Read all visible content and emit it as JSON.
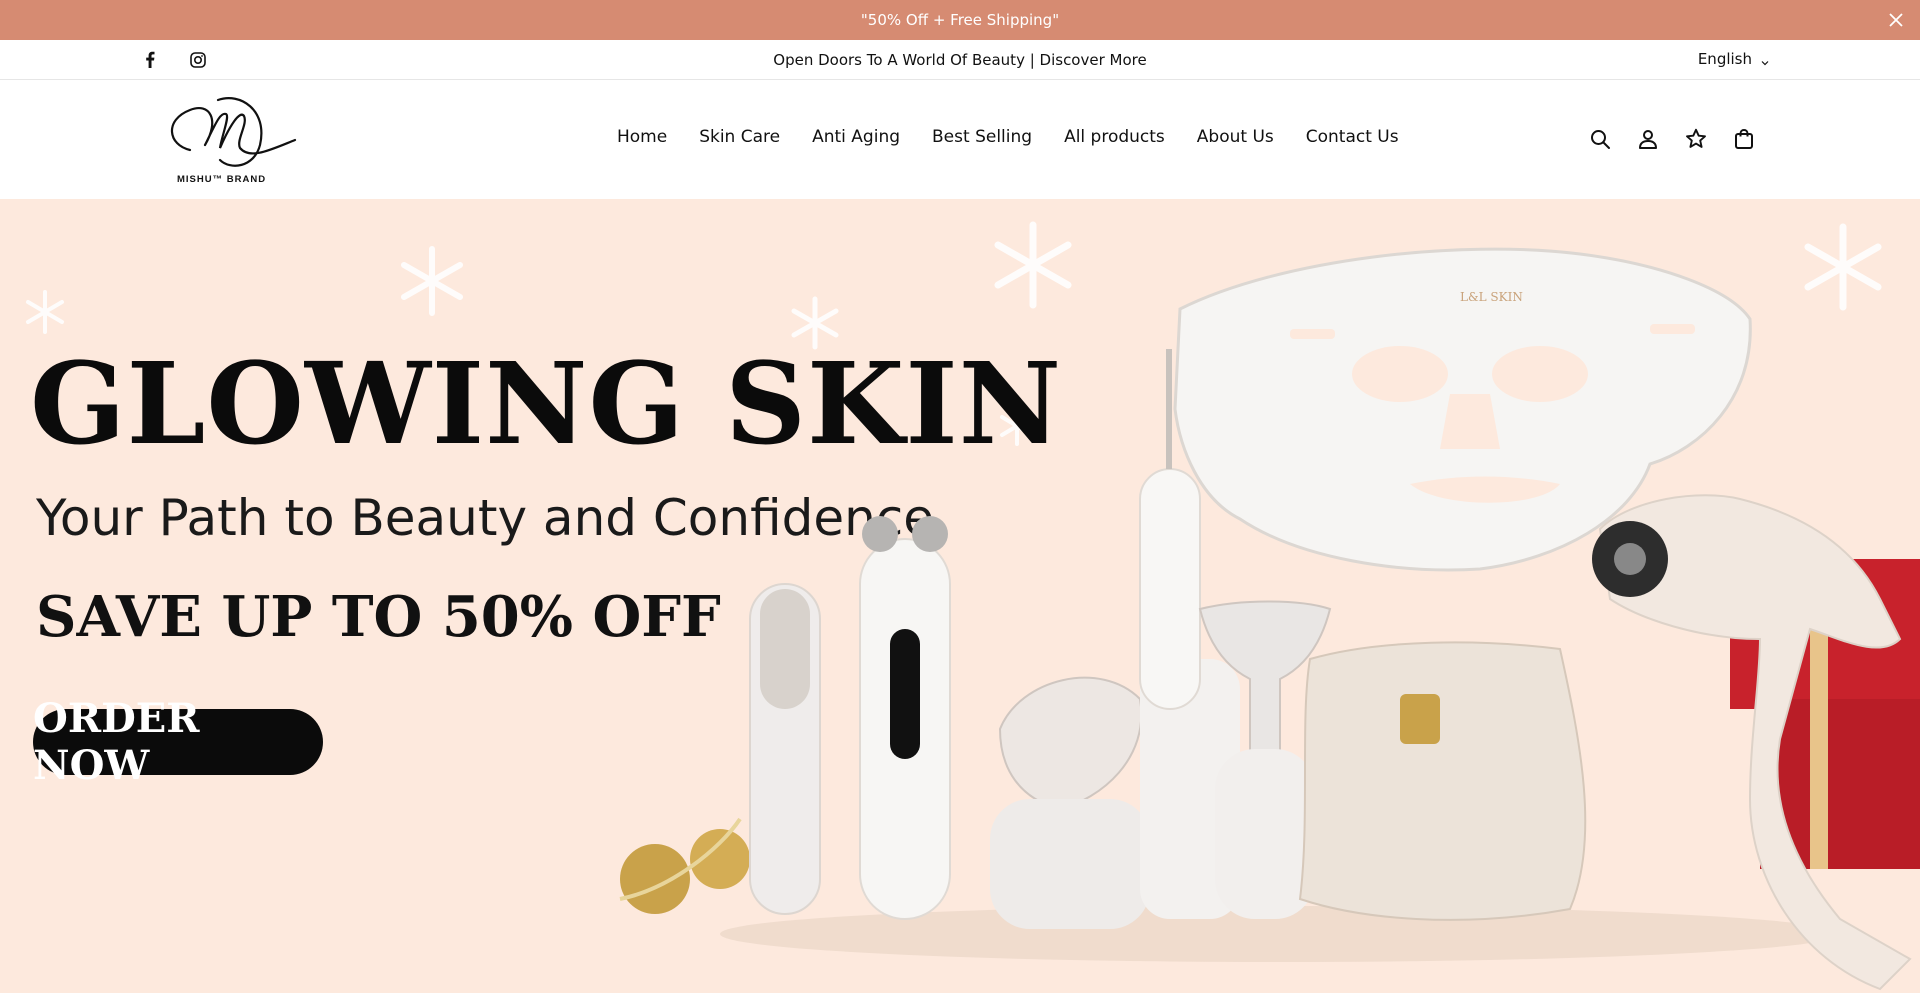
{
  "announcement": {
    "text": "\"50% Off + Free Shipping\""
  },
  "topbar": {
    "message": "Open Doors To A World Of Beauty | Discover More",
    "language": "English"
  },
  "header": {
    "logo_text": "MISHU™ BRAND",
    "nav": [
      {
        "label": "Home"
      },
      {
        "label": "Skin Care"
      },
      {
        "label": "Anti Aging"
      },
      {
        "label": "Best Selling"
      },
      {
        "label": "All products"
      },
      {
        "label": "About Us"
      },
      {
        "label": "Contact Us"
      }
    ]
  },
  "hero": {
    "title": "GLOWING SKIN",
    "subtitle": "Your Path to Beauty and Confidence",
    "offer": "SAVE UP TO 50% OFF",
    "cta": "ORDER NOW",
    "product_brand_text": "L&L SKIN"
  },
  "colors": {
    "announcement_bg": "#d68b72",
    "hero_bg": "#fde9dd",
    "cta_bg": "#0b0b0b"
  }
}
